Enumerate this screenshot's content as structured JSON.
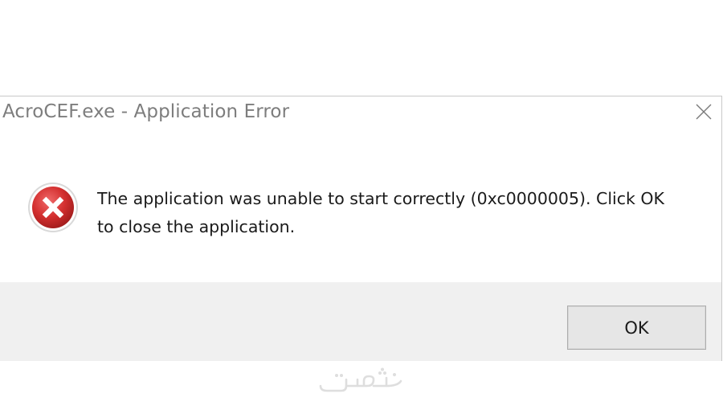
{
  "window": {
    "title": "AcroCEF.exe - Application Error",
    "close_icon": "close-icon"
  },
  "message": {
    "icon": "error-x-icon",
    "line1": "The application was unable to start correctly (0xc0000005). Click OK",
    "line2": "to close the application."
  },
  "buttons": {
    "ok_label": "OK"
  },
  "watermark": {
    "text": "خمسات",
    "color": "#dedede"
  },
  "colors": {
    "error_red": "#d32f2f",
    "footer_bg": "#f0f0f0",
    "title_text": "#7d7d7d"
  }
}
